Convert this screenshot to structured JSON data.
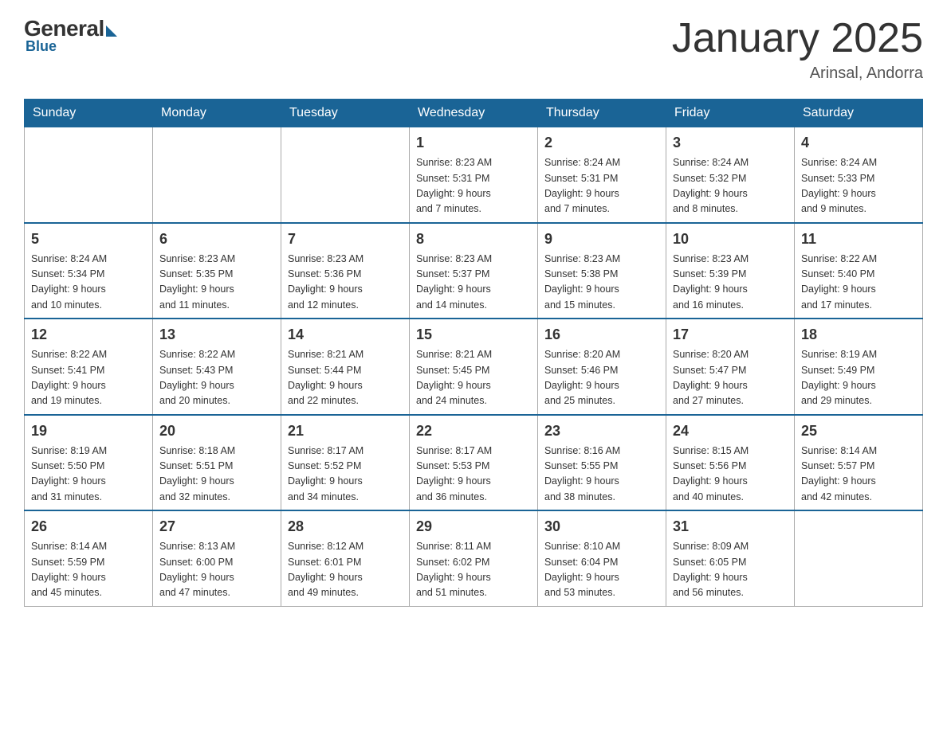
{
  "header": {
    "logo": {
      "general": "General",
      "blue": "Blue"
    },
    "title": "January 2025",
    "location": "Arinsal, Andorra"
  },
  "calendar": {
    "weekdays": [
      "Sunday",
      "Monday",
      "Tuesday",
      "Wednesday",
      "Thursday",
      "Friday",
      "Saturday"
    ],
    "weeks": [
      [
        {
          "day": "",
          "info": ""
        },
        {
          "day": "",
          "info": ""
        },
        {
          "day": "",
          "info": ""
        },
        {
          "day": "1",
          "info": "Sunrise: 8:23 AM\nSunset: 5:31 PM\nDaylight: 9 hours\nand 7 minutes."
        },
        {
          "day": "2",
          "info": "Sunrise: 8:24 AM\nSunset: 5:31 PM\nDaylight: 9 hours\nand 7 minutes."
        },
        {
          "day": "3",
          "info": "Sunrise: 8:24 AM\nSunset: 5:32 PM\nDaylight: 9 hours\nand 8 minutes."
        },
        {
          "day": "4",
          "info": "Sunrise: 8:24 AM\nSunset: 5:33 PM\nDaylight: 9 hours\nand 9 minutes."
        }
      ],
      [
        {
          "day": "5",
          "info": "Sunrise: 8:24 AM\nSunset: 5:34 PM\nDaylight: 9 hours\nand 10 minutes."
        },
        {
          "day": "6",
          "info": "Sunrise: 8:23 AM\nSunset: 5:35 PM\nDaylight: 9 hours\nand 11 minutes."
        },
        {
          "day": "7",
          "info": "Sunrise: 8:23 AM\nSunset: 5:36 PM\nDaylight: 9 hours\nand 12 minutes."
        },
        {
          "day": "8",
          "info": "Sunrise: 8:23 AM\nSunset: 5:37 PM\nDaylight: 9 hours\nand 14 minutes."
        },
        {
          "day": "9",
          "info": "Sunrise: 8:23 AM\nSunset: 5:38 PM\nDaylight: 9 hours\nand 15 minutes."
        },
        {
          "day": "10",
          "info": "Sunrise: 8:23 AM\nSunset: 5:39 PM\nDaylight: 9 hours\nand 16 minutes."
        },
        {
          "day": "11",
          "info": "Sunrise: 8:22 AM\nSunset: 5:40 PM\nDaylight: 9 hours\nand 17 minutes."
        }
      ],
      [
        {
          "day": "12",
          "info": "Sunrise: 8:22 AM\nSunset: 5:41 PM\nDaylight: 9 hours\nand 19 minutes."
        },
        {
          "day": "13",
          "info": "Sunrise: 8:22 AM\nSunset: 5:43 PM\nDaylight: 9 hours\nand 20 minutes."
        },
        {
          "day": "14",
          "info": "Sunrise: 8:21 AM\nSunset: 5:44 PM\nDaylight: 9 hours\nand 22 minutes."
        },
        {
          "day": "15",
          "info": "Sunrise: 8:21 AM\nSunset: 5:45 PM\nDaylight: 9 hours\nand 24 minutes."
        },
        {
          "day": "16",
          "info": "Sunrise: 8:20 AM\nSunset: 5:46 PM\nDaylight: 9 hours\nand 25 minutes."
        },
        {
          "day": "17",
          "info": "Sunrise: 8:20 AM\nSunset: 5:47 PM\nDaylight: 9 hours\nand 27 minutes."
        },
        {
          "day": "18",
          "info": "Sunrise: 8:19 AM\nSunset: 5:49 PM\nDaylight: 9 hours\nand 29 minutes."
        }
      ],
      [
        {
          "day": "19",
          "info": "Sunrise: 8:19 AM\nSunset: 5:50 PM\nDaylight: 9 hours\nand 31 minutes."
        },
        {
          "day": "20",
          "info": "Sunrise: 8:18 AM\nSunset: 5:51 PM\nDaylight: 9 hours\nand 32 minutes."
        },
        {
          "day": "21",
          "info": "Sunrise: 8:17 AM\nSunset: 5:52 PM\nDaylight: 9 hours\nand 34 minutes."
        },
        {
          "day": "22",
          "info": "Sunrise: 8:17 AM\nSunset: 5:53 PM\nDaylight: 9 hours\nand 36 minutes."
        },
        {
          "day": "23",
          "info": "Sunrise: 8:16 AM\nSunset: 5:55 PM\nDaylight: 9 hours\nand 38 minutes."
        },
        {
          "day": "24",
          "info": "Sunrise: 8:15 AM\nSunset: 5:56 PM\nDaylight: 9 hours\nand 40 minutes."
        },
        {
          "day": "25",
          "info": "Sunrise: 8:14 AM\nSunset: 5:57 PM\nDaylight: 9 hours\nand 42 minutes."
        }
      ],
      [
        {
          "day": "26",
          "info": "Sunrise: 8:14 AM\nSunset: 5:59 PM\nDaylight: 9 hours\nand 45 minutes."
        },
        {
          "day": "27",
          "info": "Sunrise: 8:13 AM\nSunset: 6:00 PM\nDaylight: 9 hours\nand 47 minutes."
        },
        {
          "day": "28",
          "info": "Sunrise: 8:12 AM\nSunset: 6:01 PM\nDaylight: 9 hours\nand 49 minutes."
        },
        {
          "day": "29",
          "info": "Sunrise: 8:11 AM\nSunset: 6:02 PM\nDaylight: 9 hours\nand 51 minutes."
        },
        {
          "day": "30",
          "info": "Sunrise: 8:10 AM\nSunset: 6:04 PM\nDaylight: 9 hours\nand 53 minutes."
        },
        {
          "day": "31",
          "info": "Sunrise: 8:09 AM\nSunset: 6:05 PM\nDaylight: 9 hours\nand 56 minutes."
        },
        {
          "day": "",
          "info": ""
        }
      ]
    ]
  }
}
